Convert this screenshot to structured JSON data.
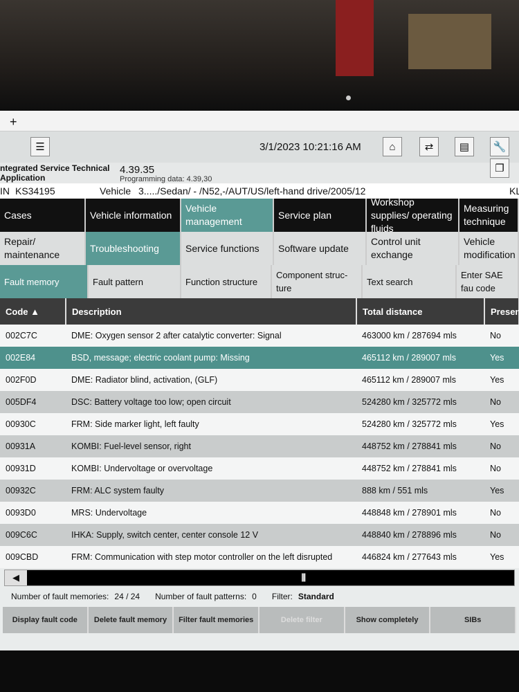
{
  "toolbar": {
    "tab_add": "+",
    "timestamp": "3/1/2023 10:21:16 AM",
    "icons": [
      "list-icon",
      "home-icon",
      "transfer-icon",
      "print-icon",
      "wrench-icon",
      "copy-icon"
    ]
  },
  "app": {
    "name_line1": "ntegrated Service Technical",
    "name_line2": "Application",
    "version": "4.39.35",
    "programming_label": "Programming data:",
    "programming_value": "4.39,30"
  },
  "vehicle": {
    "vin_label": "IN",
    "vin": "KS34195",
    "vehicle_label": "Vehicle",
    "vehicle_value": "3...../Sedan/ - /N52,-/AUT/US/left-hand drive/2005/12",
    "right": "KL"
  },
  "nav_row1": [
    "Cases",
    "Vehicle information",
    "Vehicle management",
    "Service plan",
    "Workshop supplies/ operating fluids",
    "Measuring technique"
  ],
  "nav_row2": [
    "Repair/ maintenance",
    "Troubleshooting",
    "Service functions",
    "Software update",
    "Control unit exchange",
    "Vehicle modification"
  ],
  "nav_row3": [
    "Fault memory",
    "Fault pattern",
    "Function structure",
    "Component struc- ture",
    "Text search",
    "Enter SAE fau code"
  ],
  "table": {
    "headers": [
      "Code ▲",
      "Description",
      "Total distance",
      "Presen"
    ],
    "rows": [
      [
        "002C7C",
        "DME: Oxygen sensor 2 after catalytic converter: Signal",
        "463000 km / 287694 mls",
        "No"
      ],
      [
        "002E84",
        "BSD, message; electric coolant pump: Missing",
        "465112 km / 289007 mls",
        "Yes"
      ],
      [
        "002F0D",
        "DME: Radiator blind, activation, (GLF)",
        "465112 km / 289007 mls",
        "Yes"
      ],
      [
        "005DF4",
        "DSC: Battery voltage too low; open circuit",
        "524280 km / 325772 mls",
        "No"
      ],
      [
        "00930C",
        "FRM: Side marker light, left faulty",
        "524280 km / 325772 mls",
        "Yes"
      ],
      [
        "00931A",
        "KOMBI: Fuel-level sensor, right",
        "448752 km / 278841 mls",
        "No"
      ],
      [
        "00931D",
        "KOMBI: Undervoltage or overvoltage",
        "448752 km / 278841 mls",
        "No"
      ],
      [
        "00932C",
        "FRM: ALC system faulty",
        "888 km / 551 mls",
        "Yes"
      ],
      [
        "0093D0",
        "MRS: Undervoltage",
        "448848 km / 278901 mls",
        "No"
      ],
      [
        "009C6C",
        "IHKA: Supply, switch center, center console 12 V",
        "448840 km / 278896 mls",
        "No"
      ],
      [
        "009CBD",
        "FRM: Communication with step motor controller on the left disrupted",
        "446824 km / 277643 mls",
        "Yes"
      ]
    ]
  },
  "status": {
    "fm_label": "Number of fault memories:",
    "fm_value": "24 / 24",
    "fp_label": "Number of fault patterns:",
    "fp_value": "0",
    "filter_label": "Filter:",
    "filter_value": "Standard"
  },
  "buttons": [
    "Display fault code",
    "Delete fault memory",
    "Filter fault memories",
    "Delete filter",
    "Show completely",
    "SIBs"
  ],
  "colors": {
    "accent_teal": "#5a9a95",
    "header_dark": "#3b3b3b",
    "selected_row": "#4e918c"
  }
}
